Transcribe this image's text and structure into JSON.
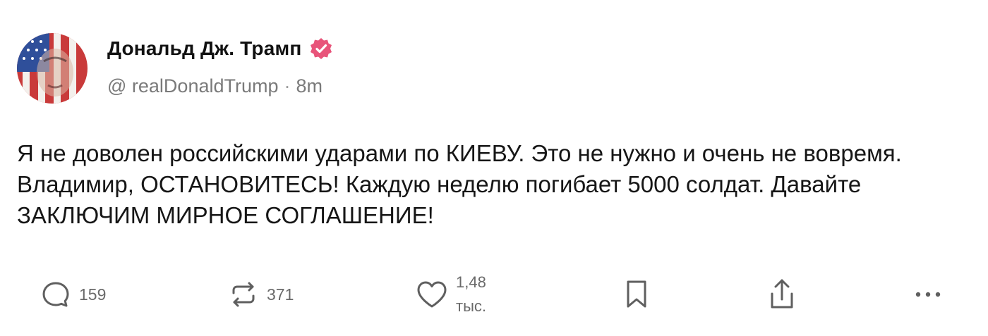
{
  "post": {
    "author": {
      "display_name": "Дональд Дж. Трамп",
      "verified_icon": "verified-badge-icon",
      "handle": "@ realDonaldTrump",
      "separator": "·",
      "time": "8m",
      "avatar": "profile-avatar"
    },
    "text": "Я не доволен российскими ударами по КИЕВУ. Это не нужно и очень не вовремя. Владимир, ОСТАНОВИТЕСЬ! Каждую неделю погибает 5000 солдат. Давайте ЗАКЛЮЧИМ МИРНОЕ СОГЛАШЕНИЕ!",
    "actions": {
      "replies": {
        "icon": "reply-icon",
        "count": "159"
      },
      "reposts": {
        "icon": "repost-icon",
        "count": "371"
      },
      "likes": {
        "icon": "heart-icon",
        "count_line1": "1,48",
        "count_line2": "тыс."
      },
      "bookmark": {
        "icon": "bookmark-icon"
      },
      "share": {
        "icon": "share-icon"
      },
      "more": {
        "icon": "more-icon"
      }
    }
  },
  "colors": {
    "verified": "#e8547a",
    "text": "#161616",
    "muted": "#7a7a7a",
    "icon": "#5f5f5f"
  }
}
